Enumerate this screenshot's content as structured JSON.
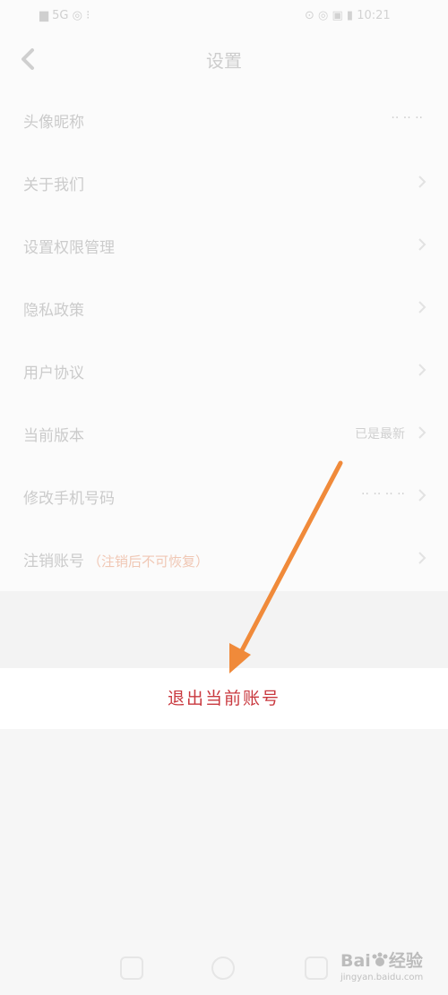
{
  "status_bar": {
    "left_text": "▆ 5G ◎ ⁝",
    "right_text": "⊙ ◎ ▣ ▮ 10:21"
  },
  "header": {
    "title": "设置",
    "back_icon": "chevron-left-icon"
  },
  "settings": [
    {
      "label": "头像昵称",
      "note": "",
      "value": "·· ·· ··",
      "chevron": false
    },
    {
      "label": "关于我们",
      "note": "",
      "value": "",
      "chevron": true
    },
    {
      "label": "设置权限管理",
      "note": "",
      "value": "",
      "chevron": true
    },
    {
      "label": "隐私政策",
      "note": "",
      "value": "",
      "chevron": true
    },
    {
      "label": "用户协议",
      "note": "",
      "value": "",
      "chevron": true
    },
    {
      "label": "当前版本",
      "note": "",
      "value": "已是最新",
      "chevron": true
    },
    {
      "label": "修改手机号码",
      "note": "",
      "value": "·· ·· ·· ··",
      "chevron": true
    },
    {
      "label": "注销账号",
      "note": "（注销后不可恢复）",
      "value": "",
      "chevron": true
    }
  ],
  "logout": {
    "label": "退出当前账号"
  },
  "annotation": {
    "arrow_color": "#f08a3a"
  },
  "bottom_nav": {
    "icons": [
      "menu-icon",
      "home-icon",
      "back-icon"
    ]
  },
  "watermark": {
    "logo_text_left": "Bai",
    "logo_text_right": "经验",
    "url": "jingyan.baidu.com"
  },
  "colors": {
    "logout_text": "#c9393f",
    "note_text": "#f0c7b4"
  }
}
